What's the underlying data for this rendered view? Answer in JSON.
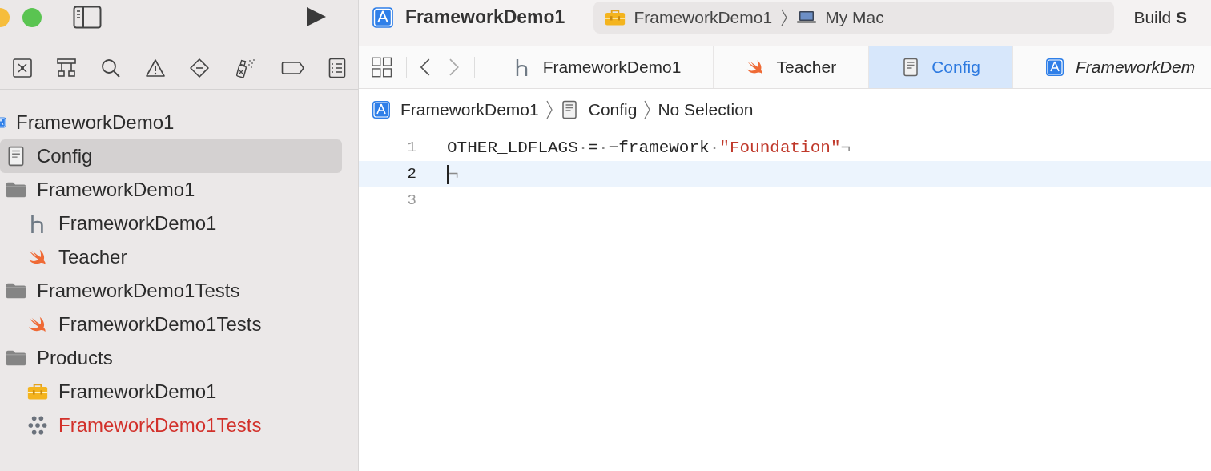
{
  "toolbar": {
    "title": "FrameworkDemo1",
    "scheme": "FrameworkDemo1",
    "destination": "My Mac",
    "status": "Build **S**"
  },
  "navigator": {
    "tree": [
      {
        "kind": "project",
        "label": "FrameworkDemo1",
        "selected": false,
        "children": [
          {
            "kind": "config",
            "label": "Config",
            "selected": true
          },
          {
            "kind": "folder",
            "label": "FrameworkDemo1",
            "selected": false,
            "children": [
              {
                "kind": "header",
                "label": "FrameworkDemo1",
                "selected": false
              },
              {
                "kind": "swift",
                "label": "Teacher",
                "selected": false
              }
            ]
          },
          {
            "kind": "folder",
            "label": "FrameworkDemo1Tests",
            "selected": false,
            "children": [
              {
                "kind": "swift",
                "label": "FrameworkDemo1Tests",
                "selected": false
              }
            ]
          },
          {
            "kind": "folder",
            "label": "Products",
            "selected": false,
            "children": [
              {
                "kind": "framework",
                "label": "FrameworkDemo1",
                "selected": false,
                "missing": false
              },
              {
                "kind": "xctest",
                "label": "FrameworkDemo1Tests",
                "selected": false,
                "missing": true
              }
            ]
          }
        ]
      }
    ]
  },
  "editor": {
    "tabs": [
      {
        "kind": "header",
        "label": "FrameworkDemo1",
        "selected": false,
        "preview": false
      },
      {
        "kind": "swift",
        "label": "Teacher",
        "selected": false,
        "preview": false
      },
      {
        "kind": "config",
        "label": "Config",
        "selected": true,
        "preview": false
      },
      {
        "kind": "project",
        "label": "FrameworkDem",
        "selected": false,
        "preview": true
      }
    ],
    "jump_bar": [
      {
        "kind": "project",
        "label": "FrameworkDemo1"
      },
      {
        "kind": "config",
        "label": "Config"
      },
      {
        "kind": "none",
        "label": "No Selection"
      }
    ],
    "lines": [
      {
        "number": "1",
        "current": false,
        "tokens": [
          {
            "kind": "plain",
            "text": "OTHER_LDFLAGS"
          },
          {
            "kind": "space",
            "text": "·"
          },
          {
            "kind": "plain",
            "text": "="
          },
          {
            "kind": "space",
            "text": "·"
          },
          {
            "kind": "plain",
            "text": "−framework"
          },
          {
            "kind": "space",
            "text": "·"
          },
          {
            "kind": "string",
            "text": "\"Foundation\""
          },
          {
            "kind": "space",
            "text": "¬"
          }
        ]
      },
      {
        "number": "2",
        "current": true,
        "tokens": [
          {
            "kind": "space",
            "text": "¬"
          }
        ]
      },
      {
        "number": "3",
        "current": false
      }
    ]
  }
}
